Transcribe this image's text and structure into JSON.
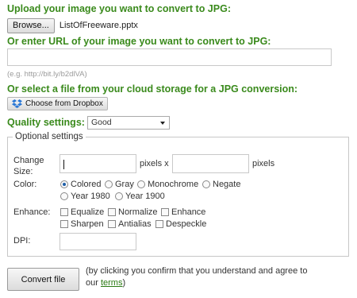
{
  "upload": {
    "heading": "Upload your image you want to convert to JPG:",
    "browse_label": "Browse...",
    "filename": "ListOfFreeware.pptx"
  },
  "url": {
    "heading": "Or enter URL of your image you want to convert to JPG:",
    "value": "",
    "hint": "(e.g. http://bit.ly/b2dlVA)"
  },
  "cloud": {
    "heading": "Or select a file from your cloud storage for a JPG conversion:",
    "dropbox_label": "Choose from Dropbox",
    "dropbox_icon": "dropbox-icon",
    "dropbox_color": "#2b78d6"
  },
  "quality": {
    "label": "Quality settings:",
    "selected": "Good"
  },
  "optional": {
    "legend": "Optional settings",
    "change_size": {
      "label": "Change Size:",
      "width_value": "",
      "height_value": "",
      "unit_x": "pixels x",
      "unit": "pixels"
    },
    "color": {
      "label": "Color:",
      "options": [
        "Colored",
        "Gray",
        "Monochrome",
        "Negate",
        "Year 1980",
        "Year 1900"
      ],
      "selected": "Colored"
    },
    "enhance": {
      "label": "Enhance:",
      "options": [
        "Equalize",
        "Normalize",
        "Enhance",
        "Sharpen",
        "Antialias",
        "Despeckle"
      ]
    },
    "dpi": {
      "label": "DPI:",
      "value": ""
    }
  },
  "convert": {
    "button_label": "Convert file",
    "note_prefix": "(by clicking you confirm that you understand and agree to our ",
    "terms_link": "terms",
    "note_suffix": ")"
  },
  "colors": {
    "heading_green": "#3a8a1c",
    "link_green": "#2a7a12",
    "radio_blue": "#1f5fa8"
  }
}
